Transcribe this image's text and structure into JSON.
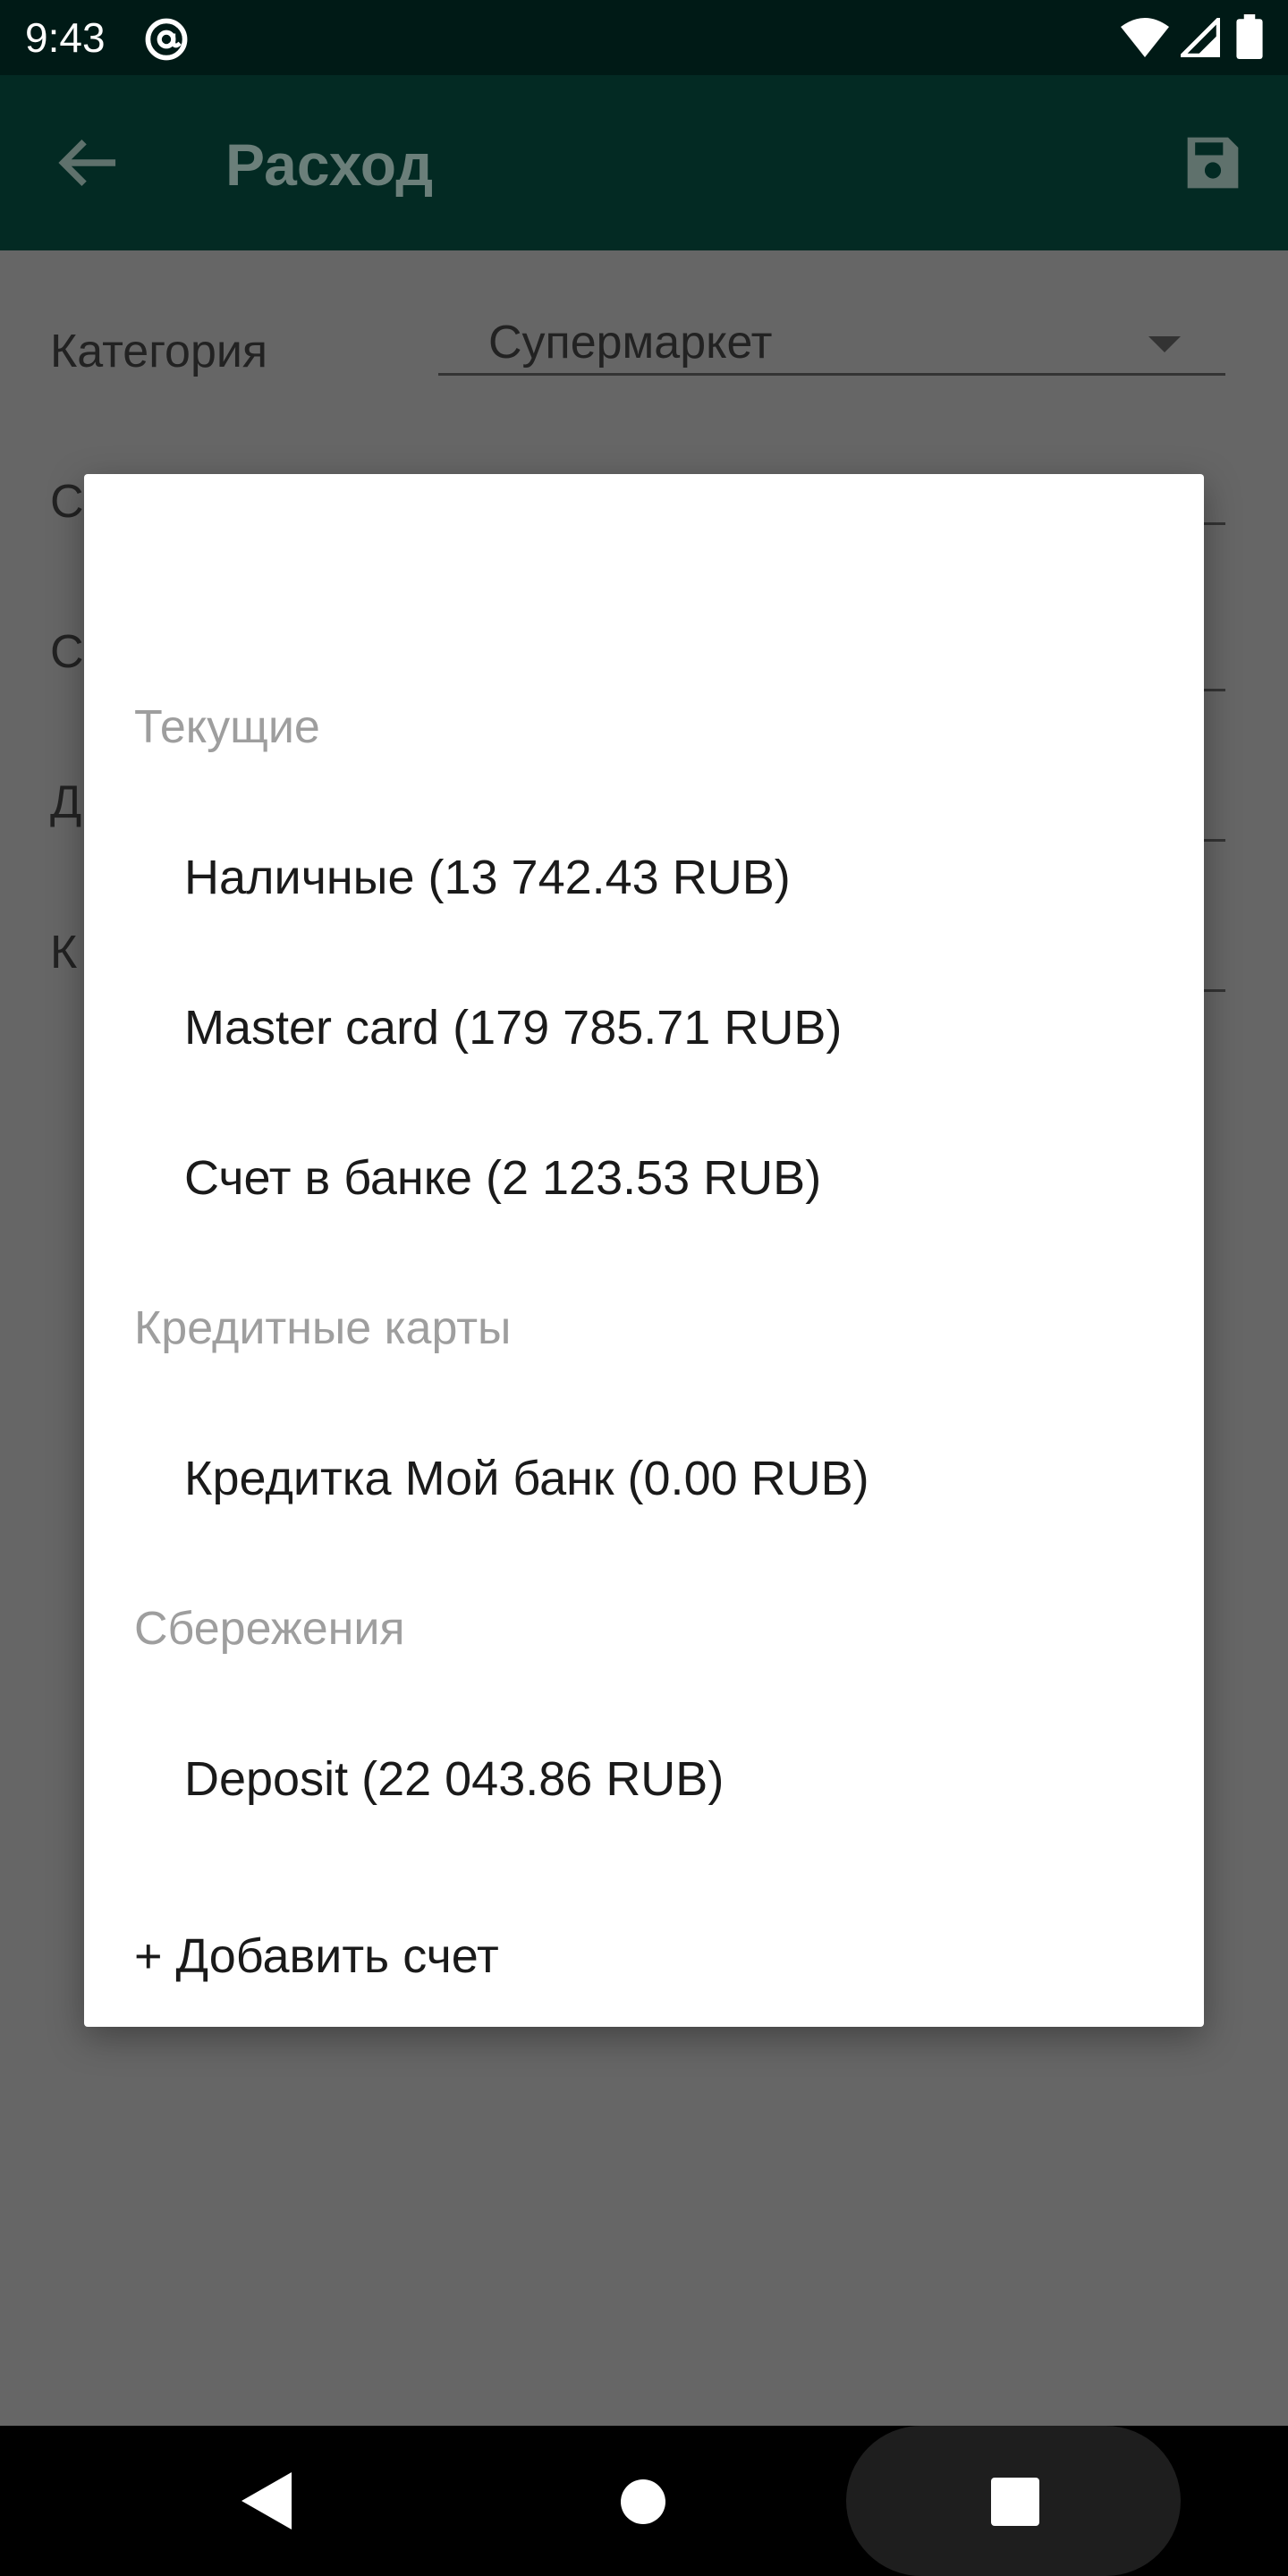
{
  "status_bar": {
    "time": "9:43",
    "icons": [
      "at-sign-icon",
      "wifi-icon",
      "signal-icon",
      "battery-icon"
    ]
  },
  "app_bar": {
    "title": "Расход",
    "back_icon": "arrow-back-icon",
    "save_icon": "save-icon"
  },
  "form": {
    "category_label": "Категория",
    "category_value": "Супермаркет",
    "row_letters": [
      "С",
      "С",
      "Д",
      "К"
    ]
  },
  "dialog": {
    "groups": [
      {
        "header": "Текущие",
        "items": [
          "Наличные (13 742.43 RUB)",
          "Master card (179 785.71 RUB)",
          "Счет в банке (2 123.53 RUB)"
        ]
      },
      {
        "header": "Кредитные карты",
        "items": [
          "Кредитка Мой банк (0.00 RUB)"
        ]
      },
      {
        "header": "Сбережения",
        "items": [
          "Deposit (22 043.86 RUB)"
        ]
      }
    ],
    "add_account": "+ Добавить счет"
  },
  "nav_bar": {
    "icons": [
      "nav-back-icon",
      "nav-home-icon",
      "nav-recents-icon"
    ]
  },
  "colors": {
    "status_bar": "#001a16",
    "app_bar_dimmed": "#032a23",
    "scrim_background": "#666666",
    "group_header": "#9e9e9e",
    "dialog_background": "#ffffff"
  }
}
